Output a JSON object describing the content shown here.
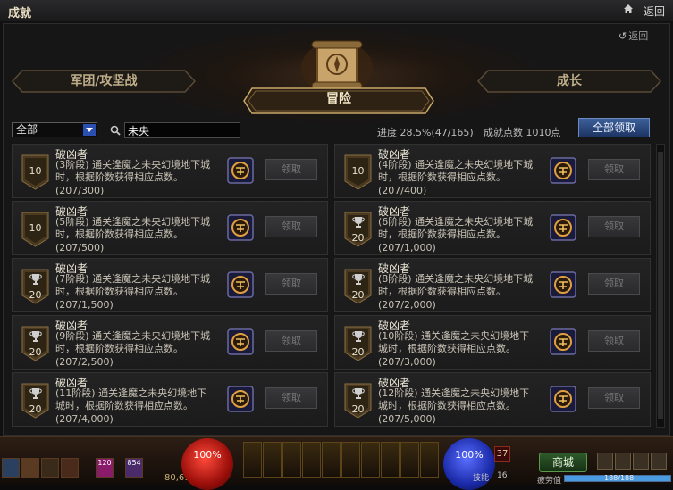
{
  "window": {
    "title": "成就",
    "back_label": "返回"
  },
  "panel": {
    "back_label": "返回"
  },
  "tabs": {
    "left": "军团/攻坚战",
    "main": "冒险",
    "right": "成长"
  },
  "filter": {
    "selected": "全部"
  },
  "search": {
    "value": "未央"
  },
  "summary": {
    "progress": "进度 28.5%(47/165)",
    "points": "成就点数 1010点",
    "claim_all": "全部领取"
  },
  "achievements": [
    {
      "name": "破凶者",
      "desc": "(3阶段) 通关逢魔之未央幻境地下城时，根据阶数获得相应点数。",
      "progress": "(207/300)",
      "points": "10",
      "badge": "plain",
      "claim": "领取"
    },
    {
      "name": "破凶者",
      "desc": "(4阶段) 通关逢魔之未央幻境地下城时，根据阶数获得相应点数。",
      "progress": "(207/400)",
      "points": "10",
      "badge": "plain",
      "claim": "领取"
    },
    {
      "name": "破凶者",
      "desc": "(5阶段) 通关逢魔之未央幻境地下城时，根据阶数获得相应点数。",
      "progress": "(207/500)",
      "points": "10",
      "badge": "plain",
      "claim": "领取"
    },
    {
      "name": "破凶者",
      "desc": "(6阶段) 通关逢魔之未央幻境地下城时，根据阶数获得相应点数。",
      "progress": "(207/1,000)",
      "points": "20",
      "badge": "cup",
      "claim": "领取"
    },
    {
      "name": "破凶者",
      "desc": "(7阶段) 通关逢魔之未央幻境地下城时，根据阶数获得相应点数。",
      "progress": "(207/1,500)",
      "points": "20",
      "badge": "cup",
      "claim": "领取"
    },
    {
      "name": "破凶者",
      "desc": "(8阶段) 通关逢魔之未央幻境地下城时，根据阶数获得相应点数。",
      "progress": "(207/2,000)",
      "points": "20",
      "badge": "cup",
      "claim": "领取"
    },
    {
      "name": "破凶者",
      "desc": "(9阶段) 通关逢魔之未央幻境地下城时，根据阶数获得相应点数。",
      "progress": "(207/2,500)",
      "points": "20",
      "badge": "cup",
      "claim": "领取"
    },
    {
      "name": "破凶者",
      "desc": "(10阶段) 通关逢魔之未央幻境地下城时，根据阶数获得相应点数。",
      "progress": "(207/3,000)",
      "points": "20",
      "badge": "cup",
      "claim": "领取"
    },
    {
      "name": "破凶者",
      "desc": "(11阶段) 通关逢魔之未央幻境地下城时，根据阶数获得相应点数。",
      "progress": "(207/4,000)",
      "points": "20",
      "badge": "cup",
      "claim": "领取"
    },
    {
      "name": "破凶者",
      "desc": "(12阶段) 通关逢魔之未央幻境地下城时，根据阶数获得相应点数。",
      "progress": "(207/5,000)",
      "points": "20",
      "badge": "cup",
      "claim": "领取"
    }
  ],
  "hud": {
    "hp": "100%",
    "mp": "100%",
    "gold": "80,613",
    "level": "37",
    "skill_label": "技能",
    "skill_points": "16",
    "shop": "商城",
    "fatigue_label": "疲劳值",
    "fatigue_value": "188/188",
    "fatigue_fraction": 1.0,
    "item_counts": [
      "120",
      "854"
    ]
  },
  "colors": {
    "accent": "#c9a86a",
    "claim_all_bg": "#2a4a80",
    "hp": "#c8201a",
    "mp": "#2a3ac8"
  }
}
